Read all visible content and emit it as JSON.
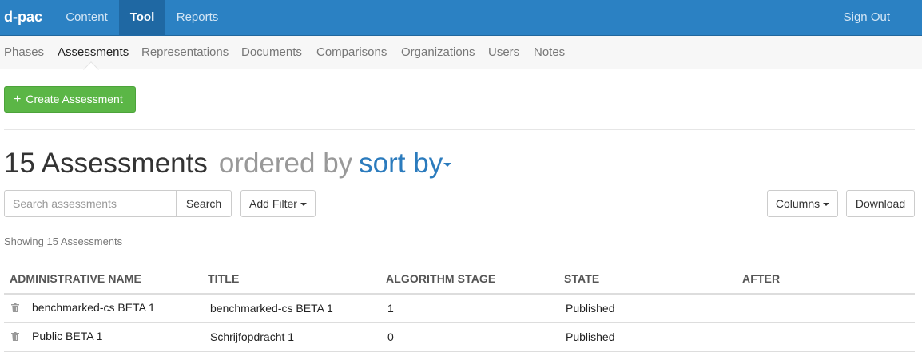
{
  "topbar": {
    "brand": "d-pac",
    "nav": [
      {
        "label": "Content"
      },
      {
        "label": "Tool",
        "active": true
      },
      {
        "label": "Reports"
      }
    ],
    "sign_out": "Sign Out"
  },
  "subnav": {
    "items": [
      {
        "label": "Phases"
      },
      {
        "label": "Assessments",
        "active": true
      },
      {
        "label": "Representations"
      },
      {
        "label": "Documents"
      },
      {
        "label": "Comparisons"
      },
      {
        "label": "Organizations"
      },
      {
        "label": "Users"
      },
      {
        "label": "Notes"
      }
    ]
  },
  "actions": {
    "create_label": "Create Assessment",
    "create_icon": "plus-icon"
  },
  "heading": {
    "count_title": "15 Assessments",
    "ordered_by": "ordered by",
    "sort_by": "sort by"
  },
  "toolbar": {
    "search_placeholder": "Search assessments",
    "search_label": "Search",
    "add_filter_label": "Add Filter",
    "columns_label": "Columns",
    "download_label": "Download"
  },
  "showing_text": "Showing 15 Assessments",
  "table": {
    "columns": [
      "ADMINISTRATIVE NAME",
      "TITLE",
      "ALGORITHM STAGE",
      "STATE",
      "AFTER"
    ],
    "rows": [
      {
        "admin_name": "benchmarked-cs BETA 1",
        "title": "benchmarked-cs BETA 1",
        "stage": "1",
        "state": "Published",
        "after": ""
      },
      {
        "admin_name": "Public BETA 1",
        "title": "Schrijfopdracht 1",
        "stage": "0",
        "state": "Published",
        "after": ""
      }
    ],
    "row_icon": "trash-icon"
  },
  "colors": {
    "topbar": "#2b81c3",
    "topbar_active": "#1f68a3",
    "create_button": "#5bb646",
    "link": "#2b7bbd"
  }
}
